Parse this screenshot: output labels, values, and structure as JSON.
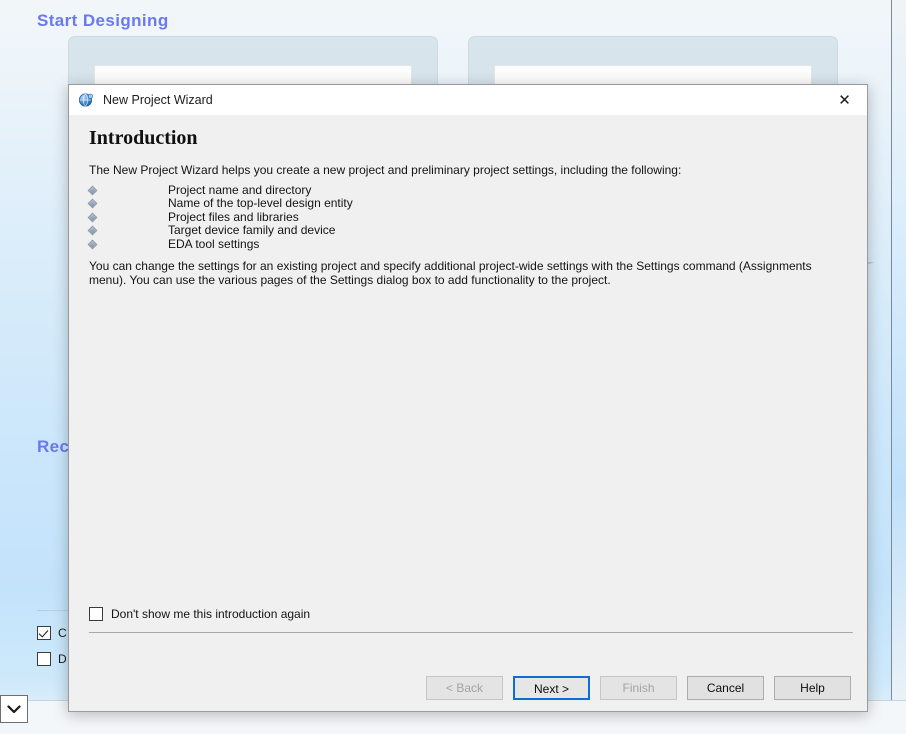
{
  "background": {
    "start_designing_heading": "Start Designing",
    "recent_heading": "Rec",
    "checkbox_rows": [
      {
        "label": "C",
        "checked": true
      },
      {
        "label": "D",
        "checked": false
      }
    ],
    "combo_icon": "chevron-down-icon",
    "accent_heading_color": "#6b79ee",
    "page_gradient_top": "#f2f6f9",
    "page_gradient_bottom": "#c3e3fb"
  },
  "dialog": {
    "title": "New Project Wizard",
    "app_icon": "quartus-globe-icon",
    "close_label": "✕",
    "heading": "Introduction",
    "intro_paragraph": "The New Project Wizard helps you create a new project and preliminary project settings, including the following:",
    "feature_list": [
      "Project name and directory",
      "Name of the top-level design entity",
      "Project files and libraries",
      "Target device family and device",
      "EDA tool settings"
    ],
    "closing_paragraph": "You can change the settings for an existing project and specify additional project-wide settings with the Settings command (Assignments menu). You can use the various pages of the Settings dialog box to add functionality to the project.",
    "dont_show_label": "Don't show me this introduction again",
    "dont_show_checked": false,
    "focus_ring_color": "#0b6fd4",
    "buttons": [
      {
        "label": "< Back",
        "state": "disabled",
        "name": "back-button"
      },
      {
        "label": "Next >",
        "state": "focused",
        "name": "next-button"
      },
      {
        "label": "Finish",
        "state": "disabled",
        "name": "finish-button"
      },
      {
        "label": "Cancel",
        "state": "enabled",
        "name": "cancel-button"
      },
      {
        "label": "Help",
        "state": "enabled",
        "name": "help-button"
      }
    ]
  }
}
